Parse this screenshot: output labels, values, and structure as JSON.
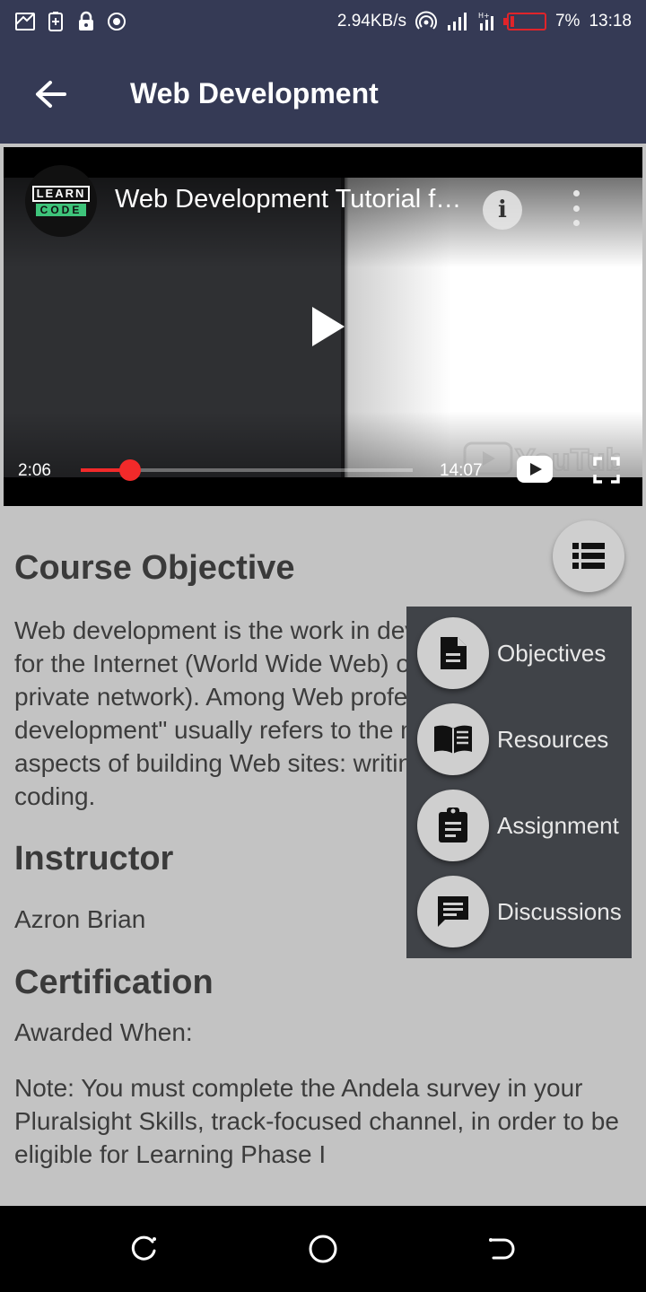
{
  "status_bar": {
    "speed": "2.94KB/s",
    "battery": "7%",
    "time": "13:18",
    "battery_color": "#e0242a"
  },
  "app_bar": {
    "title": "Web Development",
    "back_icon": "arrow-back-icon",
    "background": "#353a55"
  },
  "video": {
    "channel_logo": {
      "line1": "LEARN",
      "line2": "CODE"
    },
    "title": "Web Development Tutorial f…",
    "current_time": "2:06",
    "duration": "14:07",
    "progress_fraction": 0.149,
    "watermark": "YouTube"
  },
  "content": {
    "objective_heading": "Course Objective",
    "objective_text": "Web development is the work in developing a Web site for the Internet (World Wide Web) or an intranet (a private network). Among Web professionals, \"Web development\" usually refers to the main non-design aspects of building Web sites: writing markup and coding.",
    "instructor_heading": "Instructor",
    "instructor_name": "Azron Brian",
    "certification_heading": "Certification",
    "awarded_when": "Awarded When:",
    "note": "Note: You must complete the Andela survey in your Pluralsight Skills, track-focused channel, in order to be eligible for Learning Phase I"
  },
  "fab": {
    "toggle_icon": "list-icon",
    "items": [
      {
        "label": "Objectives",
        "icon": "document-icon"
      },
      {
        "label": "Resources",
        "icon": "book-icon"
      },
      {
        "label": "Assignment",
        "icon": "clipboard-icon"
      },
      {
        "label": "Discussions",
        "icon": "chat-icon"
      }
    ]
  },
  "nav_bar": {
    "recents_icon": "recents-icon",
    "home_icon": "home-icon",
    "back_icon": "back-icon"
  }
}
